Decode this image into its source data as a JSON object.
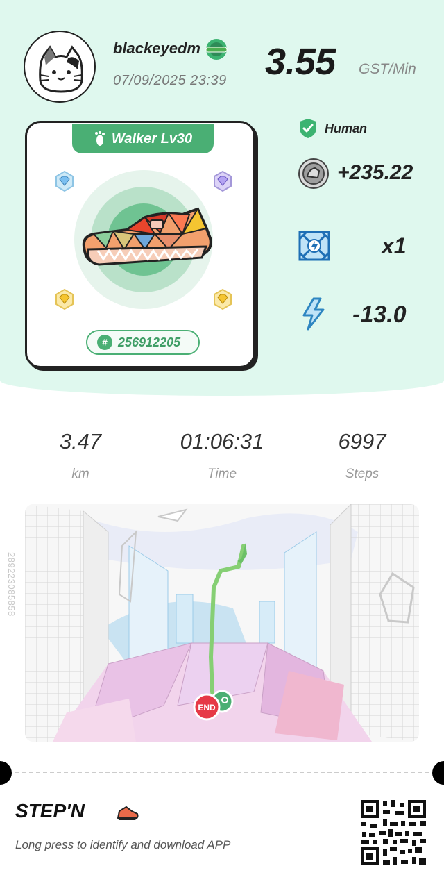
{
  "header": {
    "username": "blackeyedm",
    "datetime": "07/09/2025 23:39",
    "rate_value": "3.55",
    "rate_unit": "GST/Min"
  },
  "sneaker": {
    "type_label": "Walker Lv30",
    "id_number": "256912205"
  },
  "stats": {
    "human_label": "Human",
    "gst_earned": "+235.22",
    "multiplier": "x1",
    "energy": "-13.0"
  },
  "metrics": [
    {
      "value": "3.47",
      "label": "km"
    },
    {
      "value": "01:06:31",
      "label": "Time"
    },
    {
      "value": "6997",
      "label": "Steps"
    }
  ],
  "map": {
    "end_marker": "END",
    "side_id": "289223085858"
  },
  "footer": {
    "logo_text": "STEP'N",
    "tagline": "Long press to identify and download APP"
  },
  "colors": {
    "accent_green": "#4aaf74",
    "top_bg": "#dff8ee",
    "end_red": "#e63946"
  }
}
